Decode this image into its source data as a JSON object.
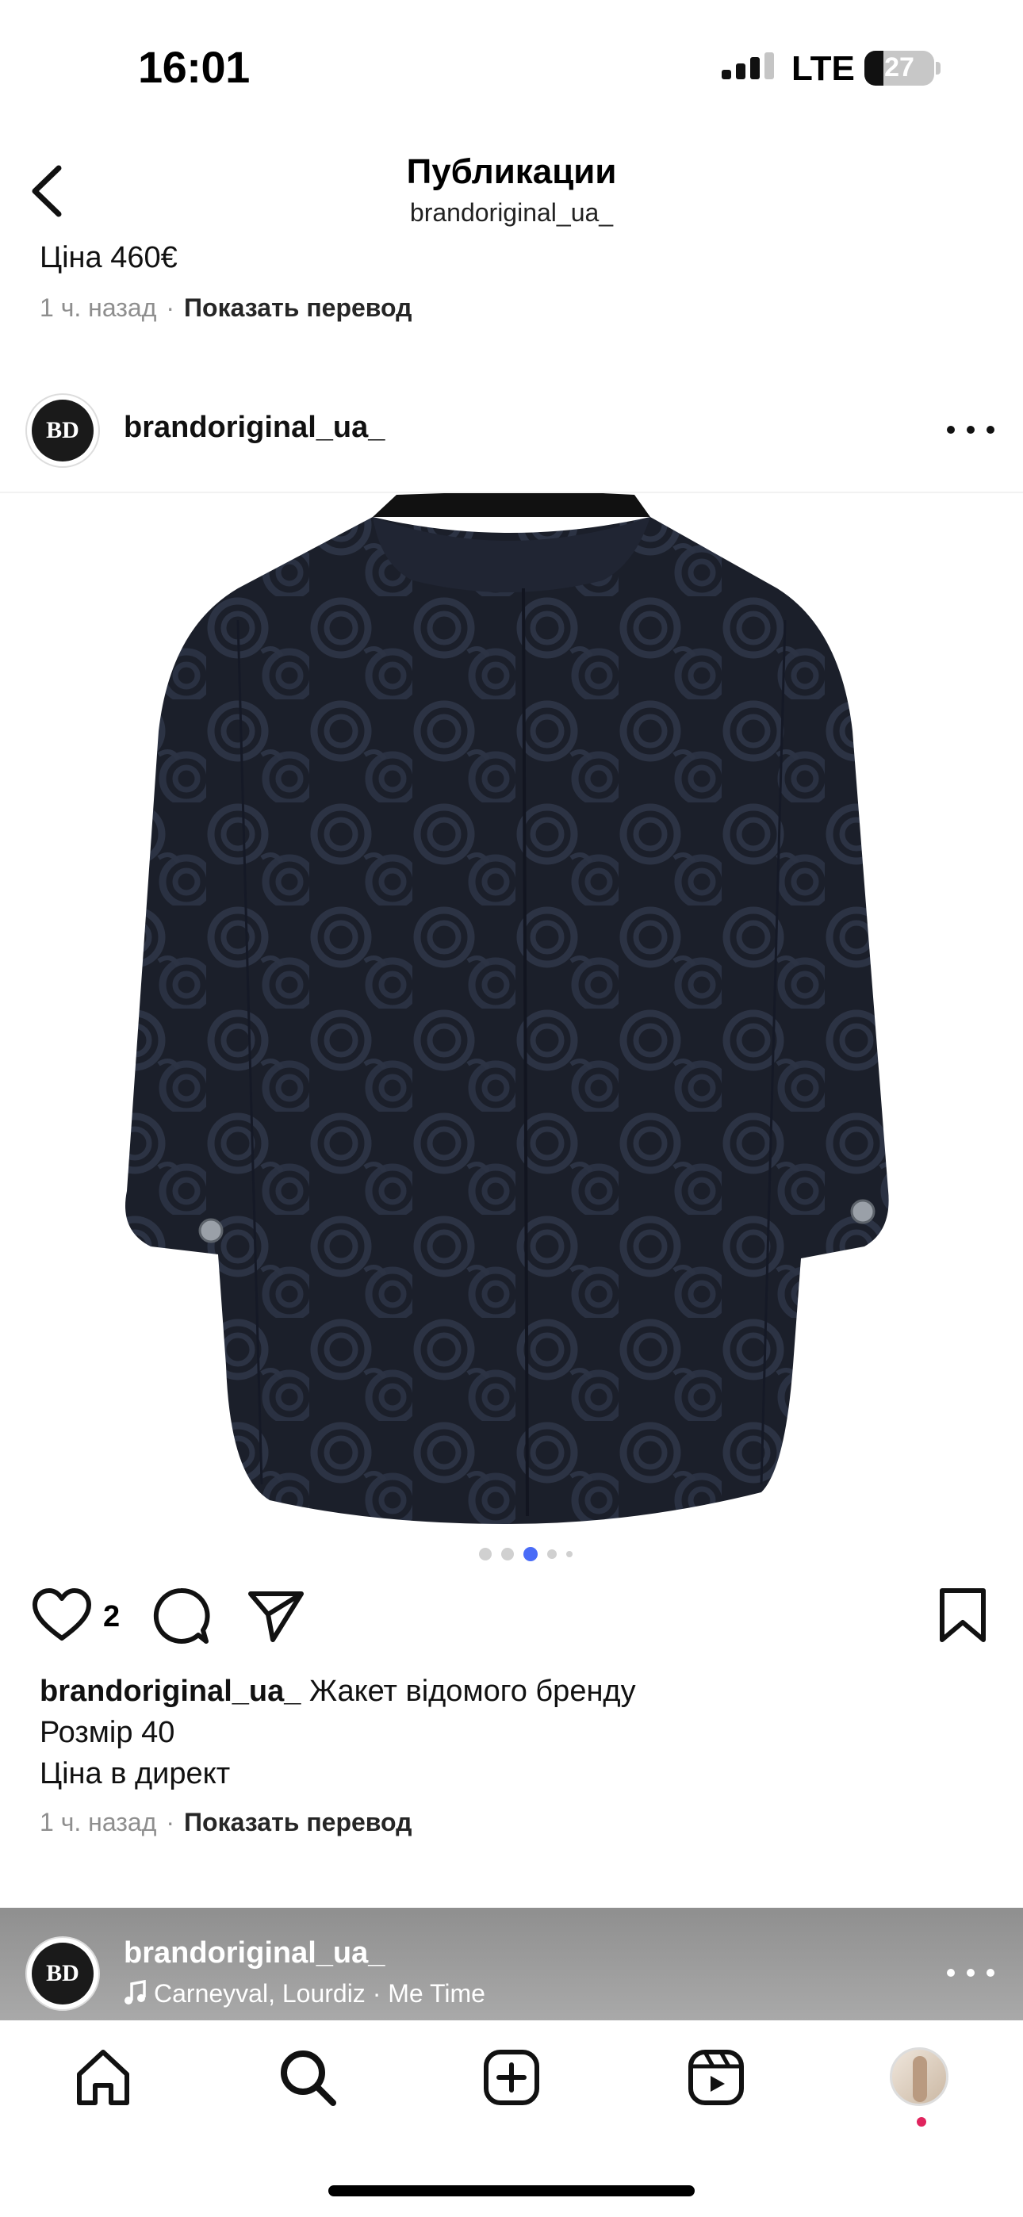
{
  "status_bar": {
    "time": "16:01",
    "network": "LTE",
    "battery": "27",
    "battery_level": 0.27
  },
  "header": {
    "title": "Публикации",
    "subtitle": "brandoriginal_ua_",
    "back_icon": "chevron-left-icon"
  },
  "previous_post": {
    "caption_line": "Ціна 460€",
    "time_ago": "1 ч. назад",
    "dot": "·",
    "translate": "Показать перевод"
  },
  "post": {
    "username": "brandoriginal_ua_",
    "avatar_text": "BD",
    "more_icon": "more-horizontal-icon",
    "image_alt": "black velvet jacket with camellia pattern on hanger",
    "carousel": {
      "count": 5,
      "active": 2
    },
    "likes": "2",
    "caption_username": "brandoriginal_ua_",
    "caption_line1": "Жакет відомого бренду",
    "caption_line2": "Розмір 40",
    "caption_line3": "Ціна в директ",
    "time_ago": "1 ч. назад",
    "dot": "·",
    "translate": "Показать перевод"
  },
  "next_post": {
    "username": "brandoriginal_ua_",
    "avatar_text": "BD",
    "music": "Carneyval, Lourdiz · Me Time"
  },
  "tabbar": [
    "home-icon",
    "search-icon",
    "create-icon",
    "reels-icon",
    "profile-icon"
  ],
  "colors": {
    "accent_dot": "#4a6cf7",
    "notification_dot": "#e0245e"
  }
}
